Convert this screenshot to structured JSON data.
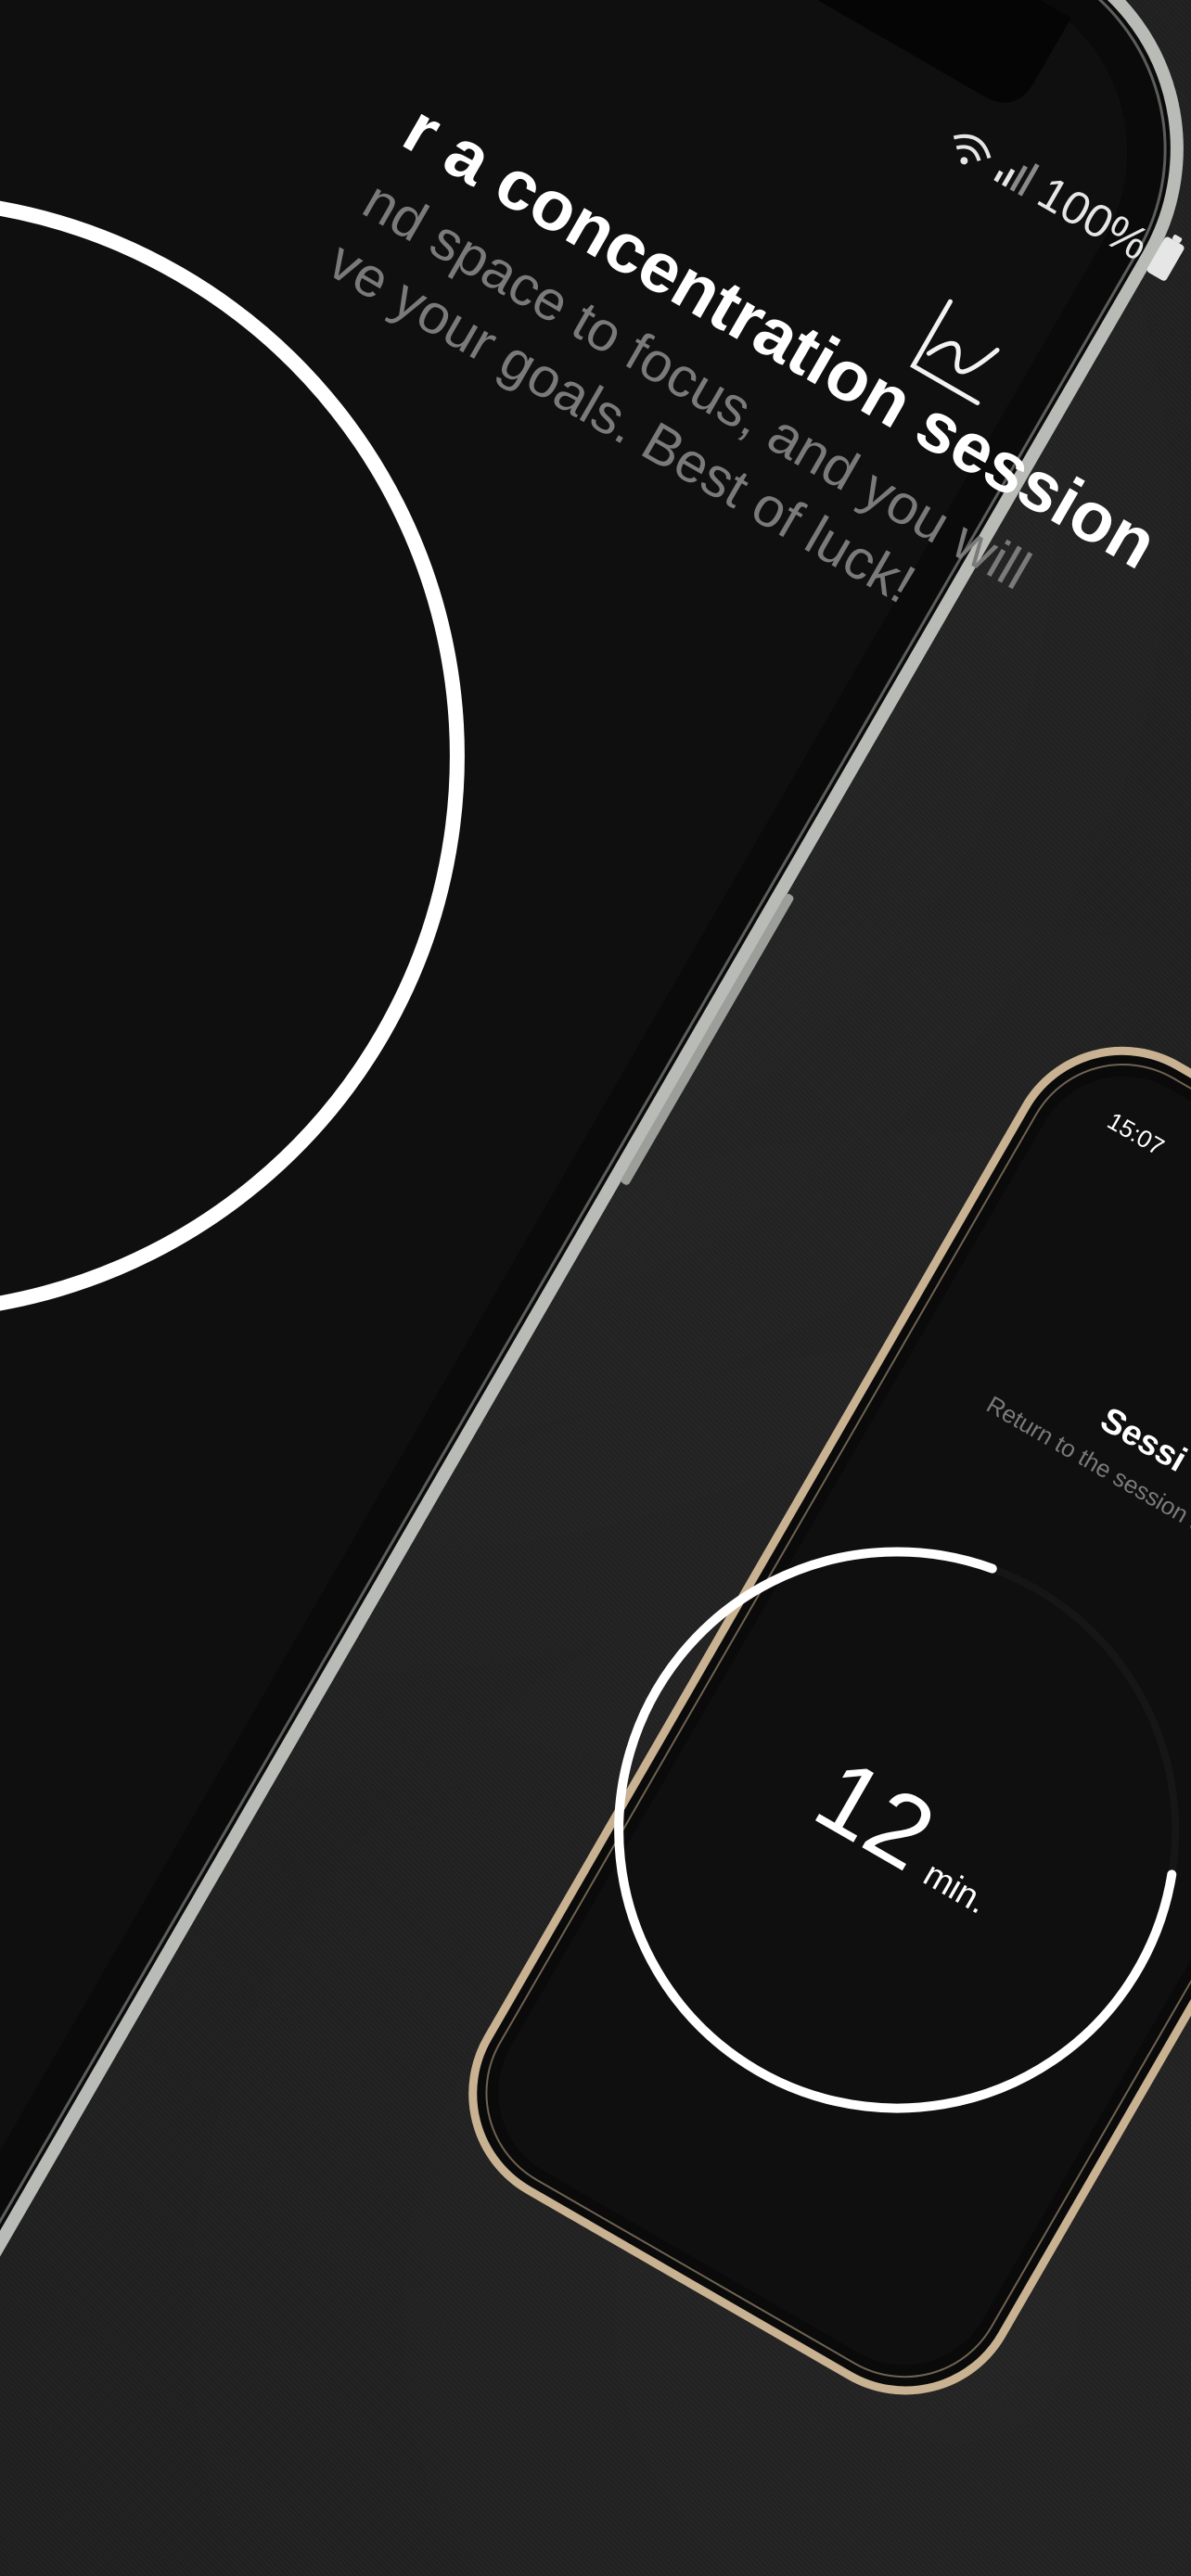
{
  "main_phone": {
    "status_bar": {
      "battery": "100%",
      "wifi_icon": "wifi-icon",
      "signal_icon": "signal-bars-icon",
      "battery_icon": "battery-icon"
    },
    "stats_icon": "line-chart-icon",
    "heading": "r a concentration session",
    "subtitle_line1": "nd space to focus, and you will",
    "subtitle_line2": "ve your goals. Best of luck!",
    "ring_icon": "timer-ring"
  },
  "second_phone": {
    "status_time": "15:07",
    "title": "Sessi",
    "subtitle": "Return to the session t",
    "timer_value": "12",
    "timer_unit": "min.",
    "progress_fraction": 0.78
  },
  "colors": {
    "background": "#1d1d1d",
    "screen": "#0e0e0e",
    "silver_frame": "#b9bbb7",
    "gold_frame": "#c9b291",
    "text_primary": "#ffffff",
    "text_secondary": "#7a7a7a"
  }
}
